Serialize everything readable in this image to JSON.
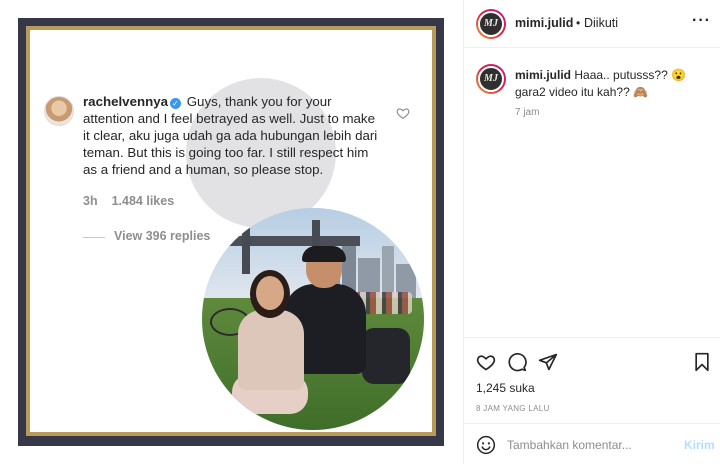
{
  "post_image": {
    "comment": {
      "username": "rachelvennya",
      "text": "Guys, thank you for your attention and I feel betrayed as well. Just to make it clear, aku juga udah ga ada hubungan lebih dari teman. But this is going too far. I still respect him as a friend and a human, so please stop.",
      "time": "3h",
      "likes": "1.484 likes",
      "view_replies": "View 396 replies"
    }
  },
  "header": {
    "username": "mimi.julid",
    "separator": "•",
    "follow_status": "Diikuti",
    "avatar_initials": "MJ"
  },
  "caption": {
    "username": "mimi.julid",
    "text": "Haaa.. putusss?? 😮 gara2 video itu kah?? 🙈",
    "time": "7 jam"
  },
  "actions": {
    "like_icon": "heart-icon",
    "comment_icon": "comment-icon",
    "share_icon": "send-icon",
    "save_icon": "bookmark-icon"
  },
  "likes": "1,245 suka",
  "date": "8 JAM YANG LALU",
  "comment_box": {
    "placeholder": "Tambahkan komentar...",
    "post_label": "Kirim"
  }
}
